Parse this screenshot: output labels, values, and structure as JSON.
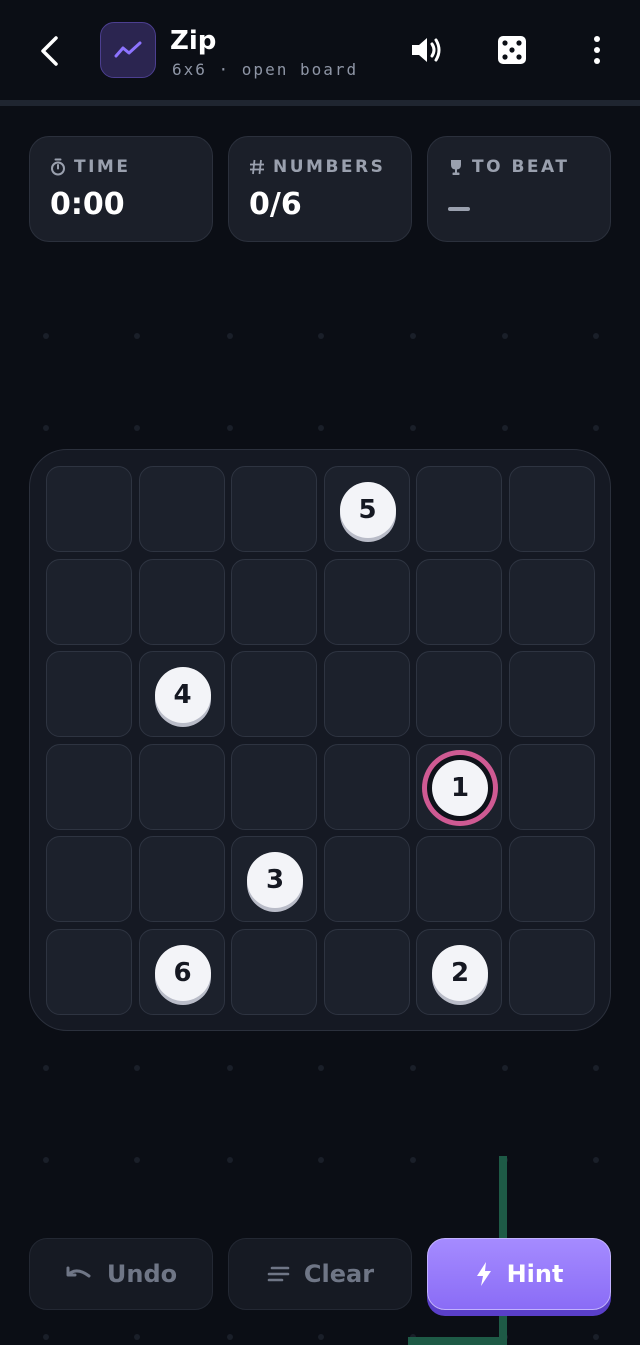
{
  "header": {
    "title": "Zip",
    "subtitle": "6x6 · open board",
    "icons": {
      "back": "chevron-left-icon",
      "logo": "zigzag-line-icon",
      "sound": "speaker-icon",
      "dice": "dice-icon",
      "menu": "more-vertical-icon"
    }
  },
  "stats": [
    {
      "label": "TIME",
      "icon": "stopwatch-icon",
      "value": "0:00"
    },
    {
      "label": "NUMBERS",
      "icon": "hash-icon",
      "value": "0/6"
    },
    {
      "label": "TO BEAT",
      "icon": "trophy-icon",
      "value": ""
    }
  ],
  "board": {
    "rows": 6,
    "cols": 6,
    "numbers": [
      {
        "value": "5",
        "row": 0,
        "col": 3
      },
      {
        "value": "4",
        "row": 2,
        "col": 1
      },
      {
        "value": "1",
        "row": 3,
        "col": 4,
        "active": true
      },
      {
        "value": "3",
        "row": 4,
        "col": 2
      },
      {
        "value": "6",
        "row": 5,
        "col": 1
      },
      {
        "value": "2",
        "row": 5,
        "col": 4
      }
    ]
  },
  "actions": {
    "undo_label": "Undo",
    "clear_label": "Clear",
    "hint_label": "Hint"
  },
  "colors": {
    "background": "#0b0e15",
    "accent": "#8a6cf6",
    "active_ring": "#cf5a93",
    "trace": "#1e5a46"
  }
}
